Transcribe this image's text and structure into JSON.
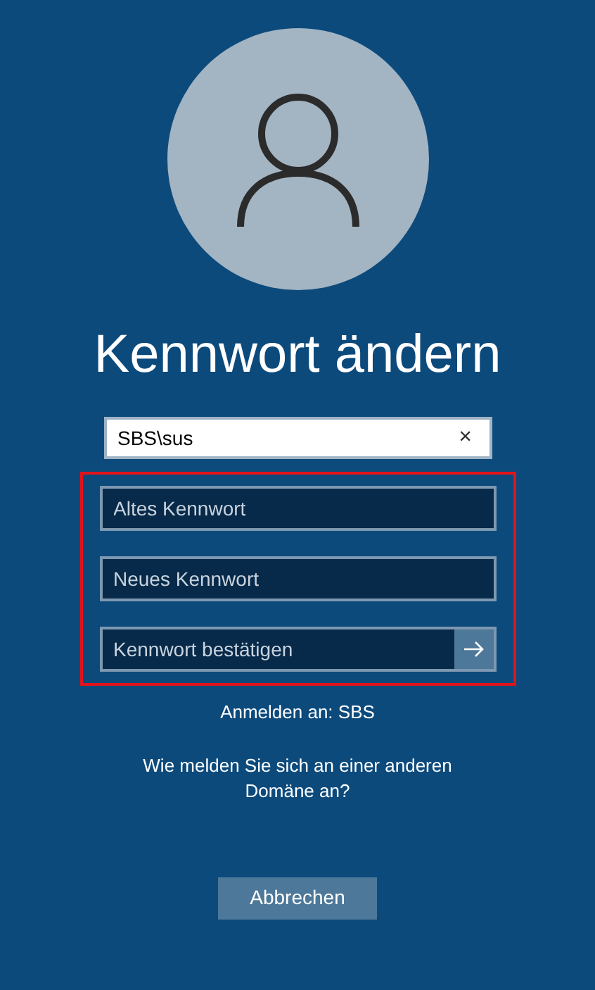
{
  "title": "Kennwort ändern",
  "username": {
    "value": "SBS\\sus",
    "clear": "×"
  },
  "password_group": {
    "highlighted": true,
    "fields": [
      {
        "placeholder": "Altes Kennwort",
        "kind": "plain"
      },
      {
        "placeholder": "Neues Kennwort",
        "kind": "plain"
      },
      {
        "placeholder": "Kennwort bestätigen",
        "kind": "submit"
      }
    ]
  },
  "sign_in_to": "Anmelden an: SBS",
  "other_domain_link": "Wie melden Sie sich an einer anderen Domäne an?",
  "cancel_button": "Abbrechen"
}
